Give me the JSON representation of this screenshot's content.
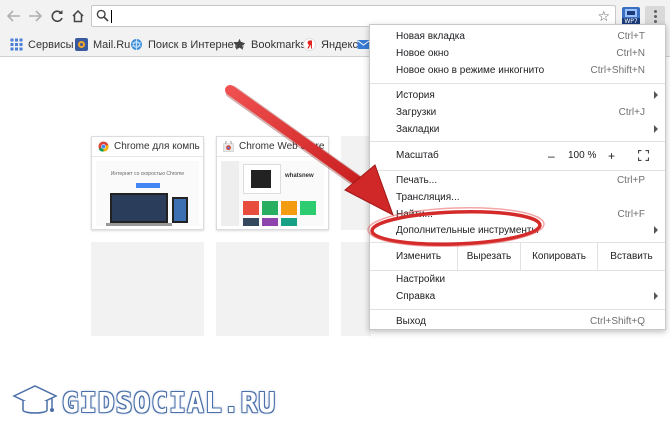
{
  "toolbar": {
    "address_value": "",
    "extension_label": "WP7"
  },
  "bookmarks": [
    {
      "label": "Сервисы",
      "icon": "apps-grid-icon"
    },
    {
      "label": "Mail.Ru",
      "icon": "mailru-icon"
    },
    {
      "label": "Поиск в Интернете",
      "icon": "search-globe-icon"
    },
    {
      "label": "Bookmarks",
      "icon": "star-icon"
    },
    {
      "label": "Яндекс",
      "icon": "yandex-icon"
    }
  ],
  "tiles": [
    {
      "title": "Chrome для компь",
      "headline": "Интернет со скоростью Chrome"
    },
    {
      "title": "Chrome Web Store",
      "headline": "whatsnew"
    }
  ],
  "menu": {
    "group1": [
      {
        "label": "Новая вкладка",
        "shortcut": "Ctrl+T"
      },
      {
        "label": "Новое окно",
        "shortcut": "Ctrl+N"
      },
      {
        "label": "Новое окно в режиме инкогнито",
        "shortcut": "Ctrl+Shift+N"
      }
    ],
    "group2": [
      {
        "label": "История",
        "submenu": true
      },
      {
        "label": "Загрузки",
        "shortcut": "Ctrl+J"
      },
      {
        "label": "Закладки",
        "submenu": true
      }
    ],
    "zoom": {
      "label": "Масштаб",
      "minus": "–",
      "value": "100 %",
      "plus": "+"
    },
    "group3": [
      {
        "label": "Печать...",
        "shortcut": "Ctrl+P"
      },
      {
        "label": "Трансляция..."
      },
      {
        "label": "Найти...",
        "shortcut": "Ctrl+F"
      },
      {
        "label": "Дополнительные инструменты",
        "submenu": true
      }
    ],
    "edit": {
      "label": "Изменить",
      "cut": "Вырезать",
      "copy": "Копировать",
      "paste": "Вставить"
    },
    "group4": [
      {
        "label": "Настройки"
      },
      {
        "label": "Справка",
        "submenu": true
      }
    ],
    "exit": {
      "label": "Выход",
      "shortcut": "Ctrl+Shift+Q"
    }
  },
  "watermark": {
    "text": "GIDSOCIAL.RU"
  },
  "colors": {
    "annotation_red": "#e03030",
    "menu_bg": "#ffffff",
    "toolbar_bg": "#f2f2f2"
  }
}
